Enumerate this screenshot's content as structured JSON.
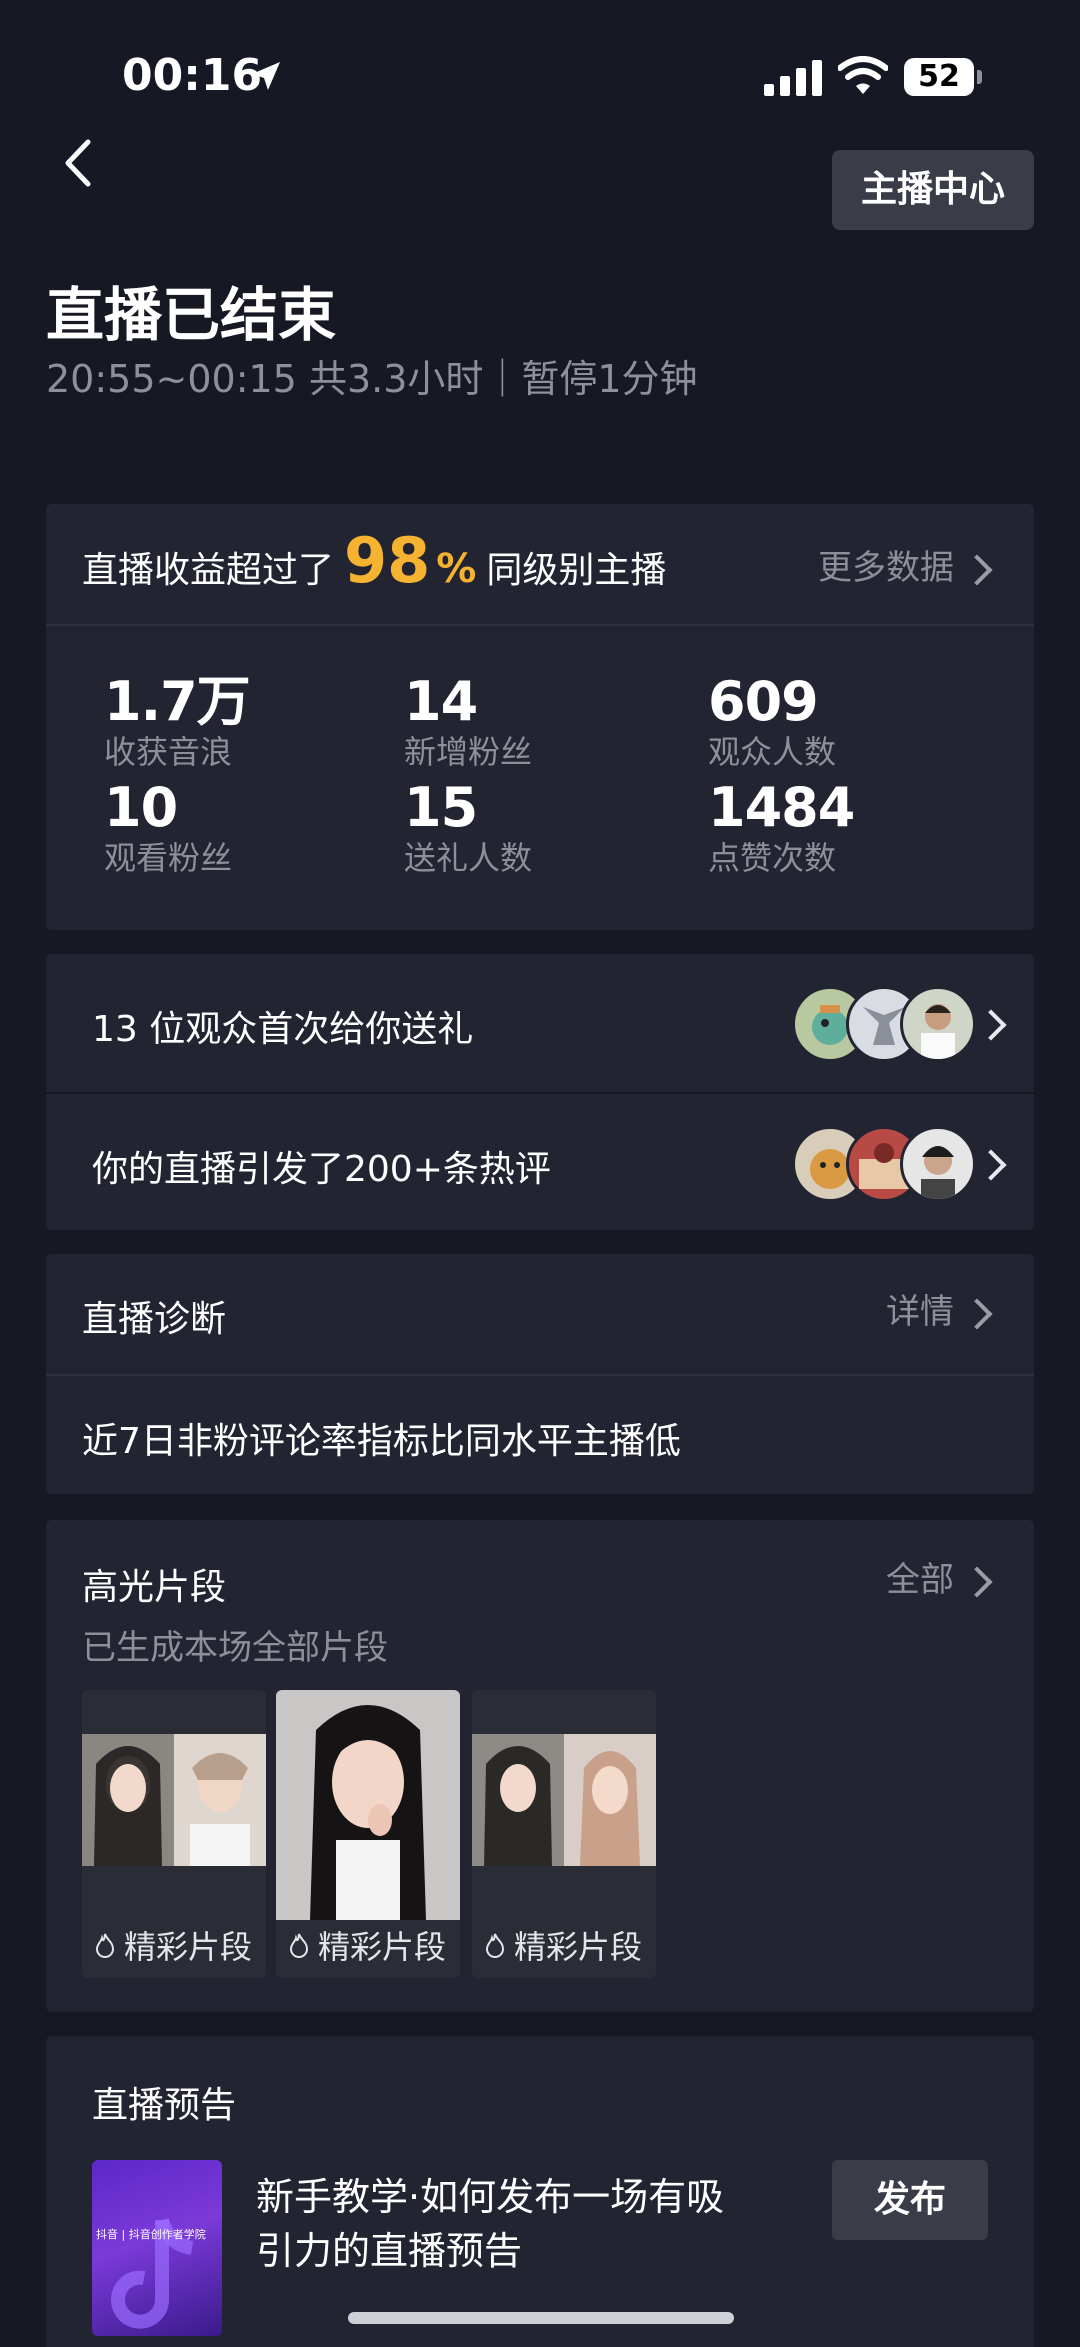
{
  "status_bar": {
    "time": "00:16",
    "battery": "52"
  },
  "header": {
    "center_button": "主播中心",
    "title": "直播已结束",
    "subtitle": "20:55~00:15 共3.3小时｜暂停1分钟"
  },
  "summary": {
    "prefix": "直播收益超过了",
    "percent": "98",
    "percent_sign": "%",
    "suffix": "同级别主播",
    "more": "更多数据",
    "stats": [
      {
        "value": "1.7万",
        "label": "收获音浪"
      },
      {
        "value": "14",
        "label": "新增粉丝"
      },
      {
        "value": "609",
        "label": "观众人数"
      },
      {
        "value": "10",
        "label": "观看粉丝"
      },
      {
        "value": "15",
        "label": "送礼人数"
      },
      {
        "value": "1484",
        "label": "点赞次数"
      }
    ]
  },
  "gifts_row": {
    "text": "13 位观众首次给你送礼"
  },
  "comments_row": {
    "text": "你的直播引发了200+条热评"
  },
  "diagnosis": {
    "title": "直播诊断",
    "detail": "详情",
    "message": "近7日非粉评论率指标比同水平主播低"
  },
  "highlights": {
    "title": "高光片段",
    "all": "全部",
    "subtitle": "已生成本场全部片段",
    "clips": [
      {
        "label": "精彩片段"
      },
      {
        "label": "精彩片段"
      },
      {
        "label": "精彩片段"
      }
    ]
  },
  "preview": {
    "title": "直播预告",
    "desc_line1": "新手教学·如何发布一场有吸",
    "desc_line2": "引力的直播预告",
    "thumb_text": "抖音 | 抖音创作者学院",
    "publish": "发布"
  },
  "colors": {
    "background": "#161824",
    "card": "#222431",
    "accent": "#f5b331",
    "muted": "#8d8f99"
  }
}
